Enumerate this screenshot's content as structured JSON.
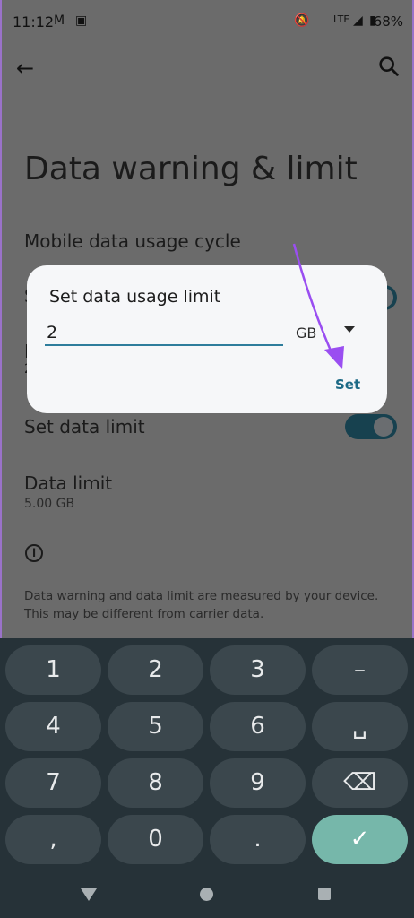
{
  "status_bar": {
    "time": "11:12",
    "gmail_icon": "M",
    "notif_icon": "▣",
    "network": "LTE",
    "battery": "68%"
  },
  "page": {
    "title": "Data warning & limit",
    "rows": {
      "usage_cycle": "Mobile data usage cycle",
      "frag_s": "S",
      "frag_i": "I",
      "frag_2": "2",
      "set_limit": "Set data limit",
      "data_limit_title": "Data limit",
      "data_limit_value": "5.00 GB"
    },
    "note": "Data warning and data limit are measured by your device. This may be different from carrier data."
  },
  "dialog": {
    "title": "Set data usage limit",
    "value": "2",
    "unit": "GB",
    "set_label": "Set"
  },
  "keyboard": {
    "keys": [
      "1",
      "2",
      "3",
      "–",
      "4",
      "5",
      "6",
      "␣",
      "7",
      "8",
      "9",
      "⌫",
      ",",
      "0",
      ".",
      "✓"
    ]
  },
  "colors": {
    "accent": "#1d6a86",
    "keyboard_bg": "#263238",
    "key_ok": "#76b7aa",
    "arrow": "#9a4ef1"
  }
}
